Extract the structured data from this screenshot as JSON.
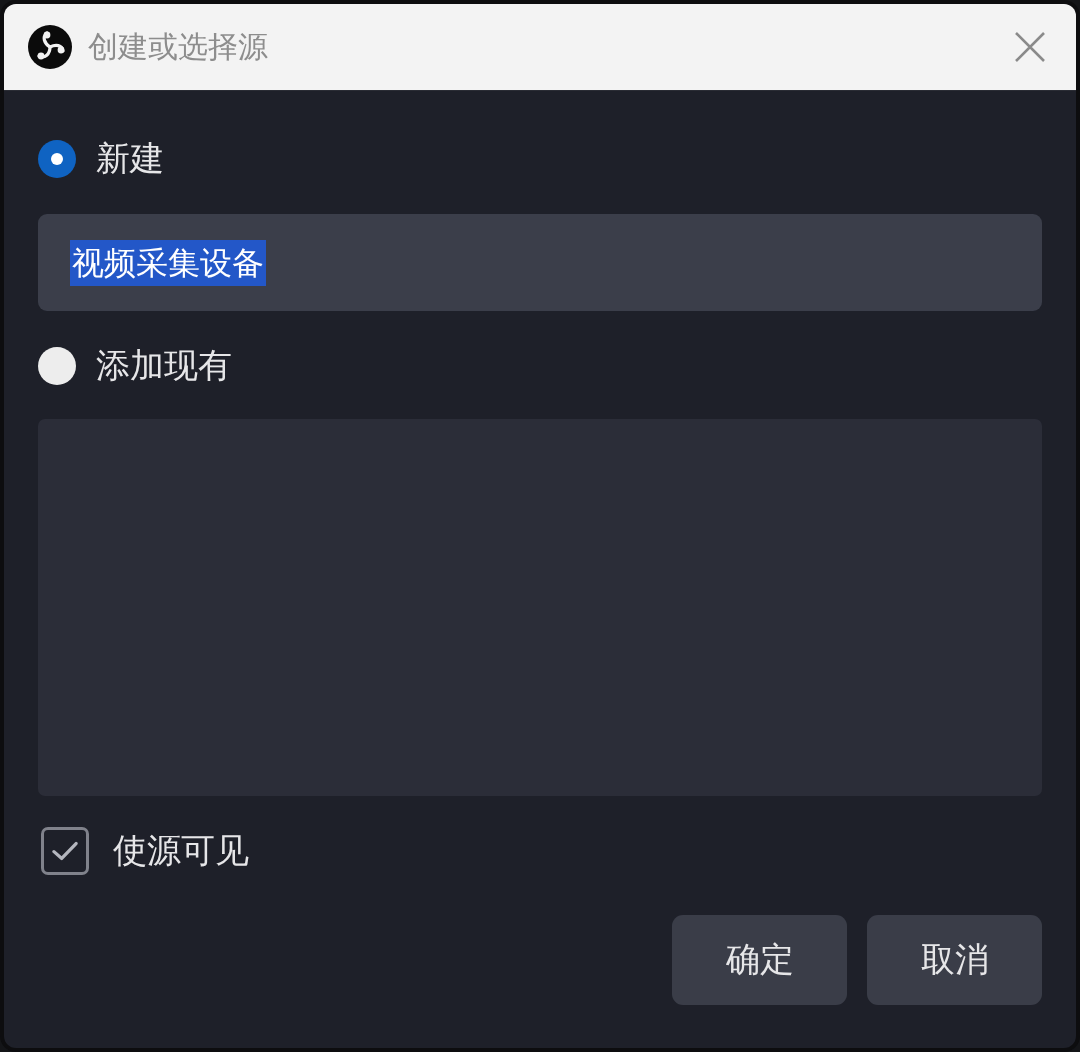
{
  "window": {
    "title": "创建或选择源"
  },
  "options": [
    {
      "kind": "new",
      "label": "新建",
      "selected": true,
      "name_field": {
        "value": "视频采集设备",
        "highlighted": true
      }
    },
    {
      "kind": "existing",
      "label": "添加现有",
      "selected": false
    }
  ],
  "visible": {
    "label": "使源可见",
    "checked": true
  },
  "buttons": [
    {
      "label": "确定"
    },
    {
      "label": "取消"
    }
  ]
}
